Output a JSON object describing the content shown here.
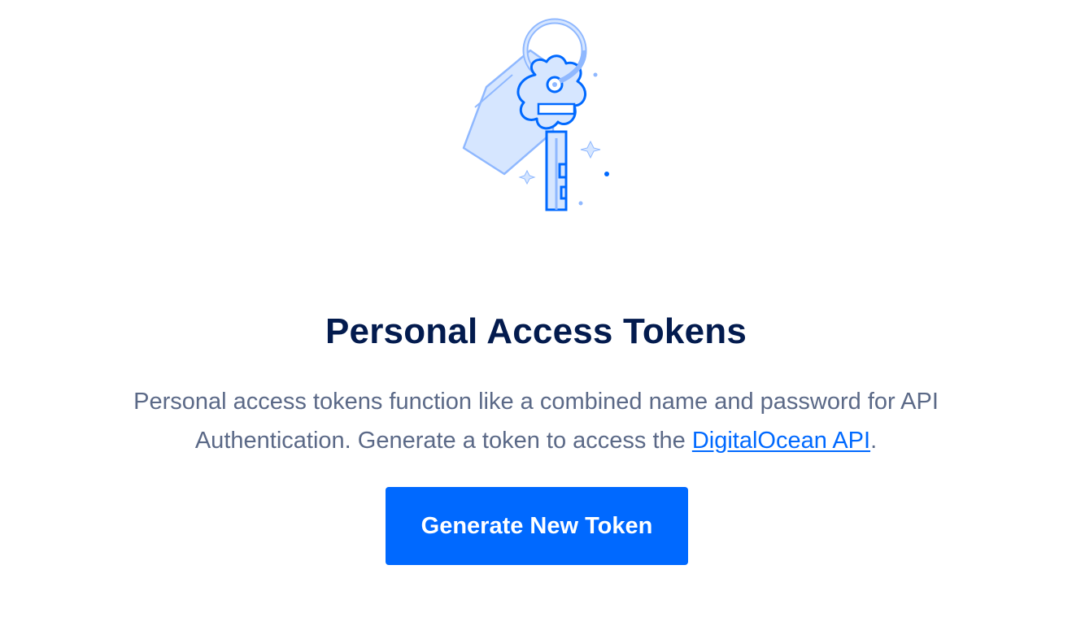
{
  "empty_state": {
    "illustration_icon": "key-with-tag-icon",
    "title": "Personal Access Tokens",
    "description_text": "Personal access tokens function like a combined name and password for API Authentication. Generate a token to access the ",
    "description_link": "DigitalOcean API",
    "description_end": ".",
    "button_label": "Generate New Token"
  },
  "colors": {
    "title": "#031b4e",
    "body_text": "#5b6987",
    "link": "#0069ff",
    "button_bg": "#0069ff",
    "button_text": "#ffffff",
    "illustration_stroke": "#0069ff",
    "illustration_fill": "#d6e6ff",
    "illustration_light": "#8fb8ff"
  }
}
